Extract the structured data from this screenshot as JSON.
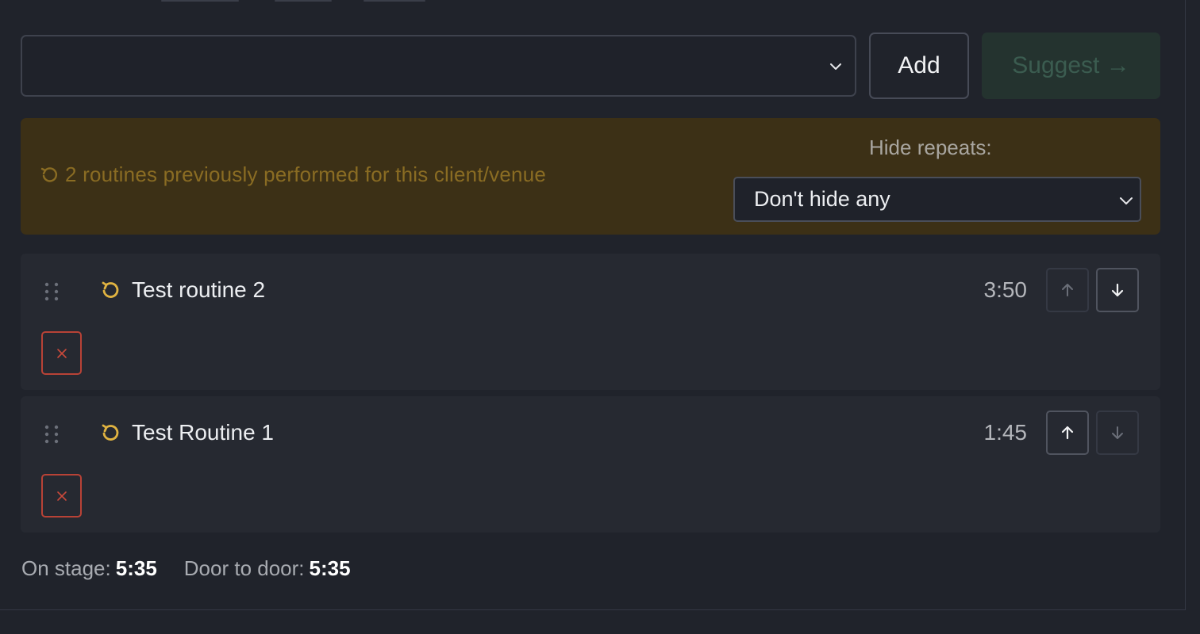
{
  "add_row": {
    "select_value": "",
    "add_label": "Add",
    "suggest_label": "Suggest →"
  },
  "banner": {
    "message": "2 routines previously performed for this client/venue",
    "hide_label": "Hide repeats:",
    "hide_value": "Don't hide any"
  },
  "routines": [
    {
      "name": "Test routine 2",
      "duration": "3:50",
      "can_move_up": false,
      "can_move_down": true
    },
    {
      "name": "Test Routine 1",
      "duration": "1:45",
      "can_move_up": true,
      "can_move_down": false
    }
  ],
  "totals": {
    "on_stage_label": "On stage:",
    "on_stage_value": "5:35",
    "door_label": "Door to door:",
    "door_value": "5:35"
  },
  "icons": {
    "repeat": "repeat-icon",
    "drag": "drag-handle-icon",
    "remove": "close-icon",
    "up": "arrow-up-icon",
    "down": "arrow-down-icon",
    "select": "chevron-down-icon"
  },
  "colors": {
    "background": "#20232b",
    "card": "#262931",
    "banner_bg": "#3c3016",
    "banner_text": "#8a6c23",
    "repeat_icon": "#e0b341",
    "danger": "#b84236",
    "suggest_disabled_bg": "#24332f",
    "suggest_disabled_text": "#3b5c50"
  }
}
